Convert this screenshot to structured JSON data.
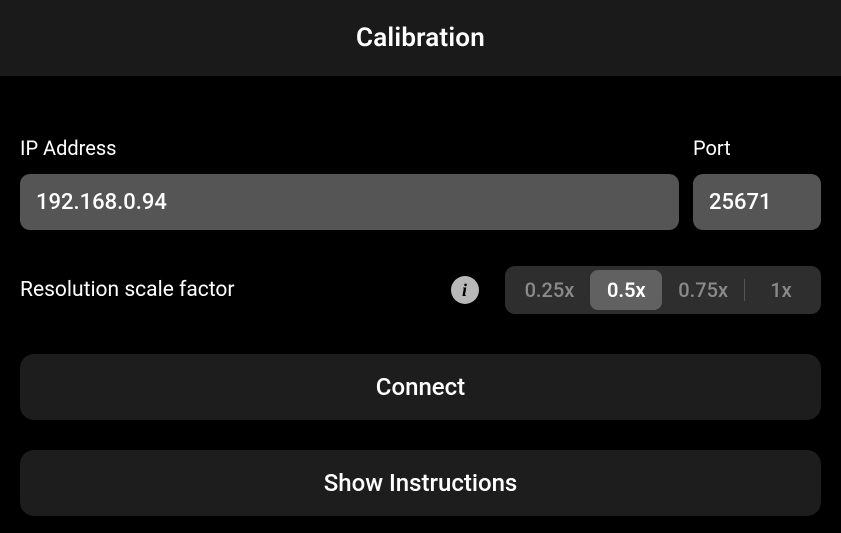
{
  "header": {
    "title": "Calibration"
  },
  "fields": {
    "ip": {
      "label": "IP Address",
      "value": "192.168.0.94"
    },
    "port": {
      "label": "Port",
      "value": "25671"
    }
  },
  "scale": {
    "label": "Resolution scale factor",
    "info_icon": "info-icon",
    "options": [
      "0.25x",
      "0.5x",
      "0.75x",
      "1x"
    ],
    "selected_index": 1
  },
  "buttons": {
    "connect": "Connect",
    "show_instructions": "Show Instructions"
  }
}
